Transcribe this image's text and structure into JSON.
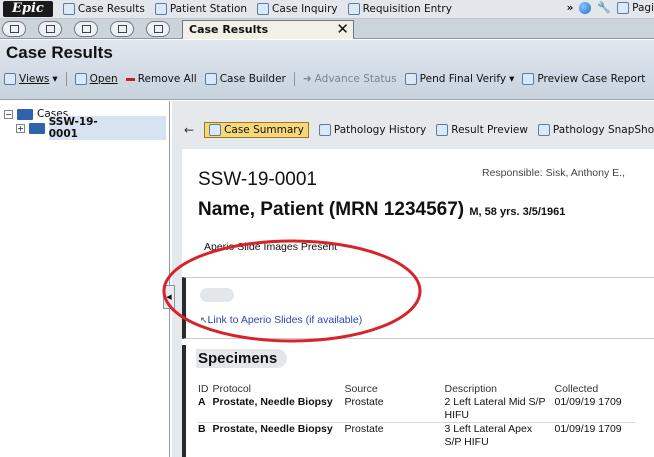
{
  "topbar": {
    "logo": "Epic",
    "items": [
      "Case Results",
      "Patient Station",
      "Case Inquiry",
      "Requisition Entry"
    ],
    "overflow": "»",
    "right_label": "Pagi"
  },
  "tabrow": {
    "active_tab": "Case Results",
    "close_glyph": "✕"
  },
  "activity": {
    "title": "Case Results",
    "toolbar": {
      "views": "Views",
      "open": "Open",
      "remove_all": "Remove All",
      "case_builder": "Case Builder",
      "advance_status": "Advance Status",
      "pend_final_verify": "Pend Final Verify",
      "preview_case_report": "Preview Case Report"
    }
  },
  "tree": {
    "root": "Cases",
    "items": [
      "SSW-19-0001"
    ]
  },
  "nav": {
    "case_summary": "Case Summary",
    "pathology_history": "Pathology History",
    "result_preview": "Result Preview",
    "pathology_snapshot": "Pathology SnapShot"
  },
  "case": {
    "id": "SSW-19-0001",
    "responsible": "Responsible: Sisk, Anthony E.,",
    "patient_name": "Name, Patient (MRN 1234567)",
    "patient_meta": "M, 58 yrs. 3/5/1961",
    "aperio_present": "Aperio Slide Images Present",
    "aperio_link": "Link to Aperio Slides (if available)"
  },
  "specimens": {
    "title": "Specimens",
    "headers": [
      "ID",
      "Protocol",
      "Source",
      "Description",
      "Collected"
    ],
    "rows": [
      {
        "id": "A",
        "protocol": "Prostate, Needle Biopsy",
        "source": "Prostate",
        "description": "2 Left Lateral Mid S/P HIFU",
        "collected": "01/09/19 1709"
      },
      {
        "id": "B",
        "protocol": "Prostate, Needle Biopsy",
        "source": "Prostate",
        "description": "3 Left Lateral Apex S/P HIFU",
        "collected": "01/09/19 1709"
      }
    ]
  },
  "colors": {
    "annotation": "#d8232a",
    "nav_active": "#f6d87a",
    "link": "#2848b8"
  }
}
